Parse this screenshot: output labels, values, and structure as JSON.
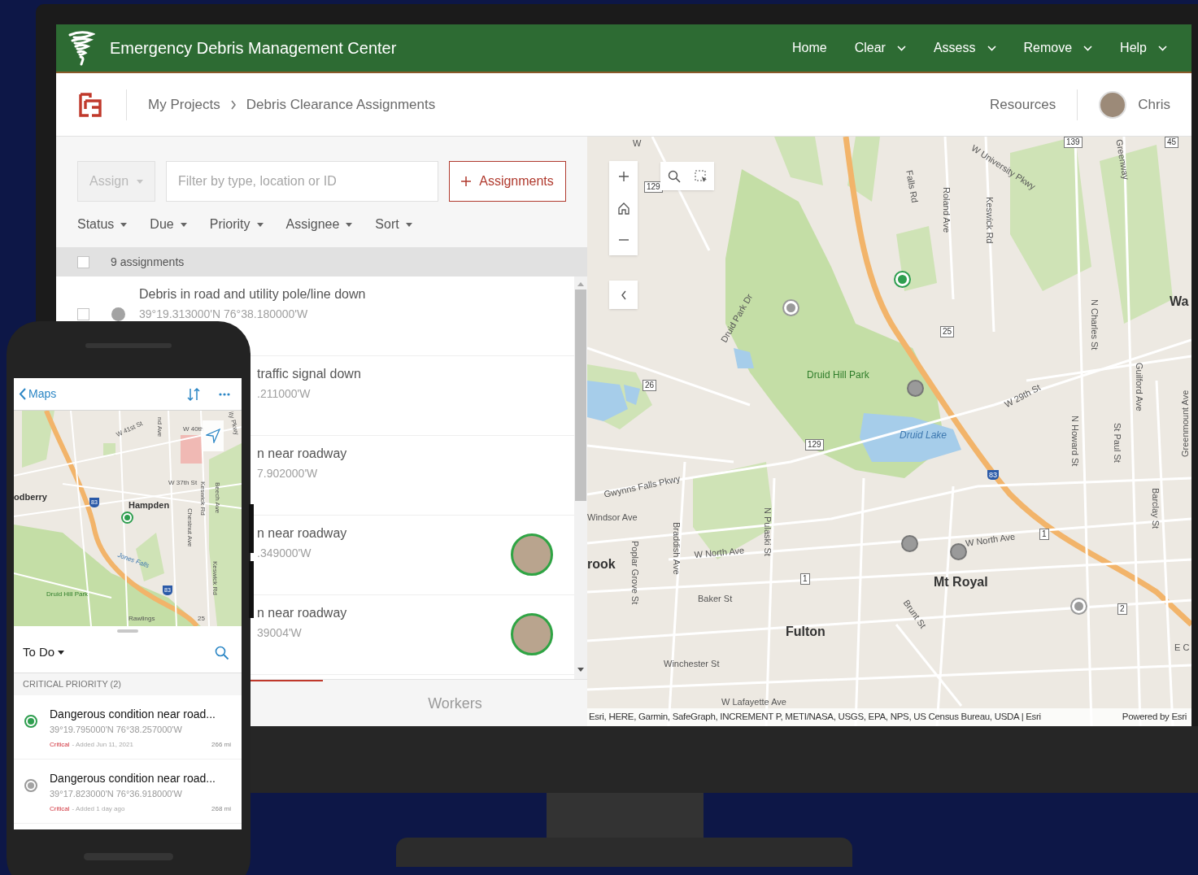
{
  "app": {
    "title": "Emergency Debris Management Center",
    "nav": [
      {
        "label": "Home",
        "menu": false
      },
      {
        "label": "Clear",
        "menu": true
      },
      {
        "label": "Assess",
        "menu": true
      },
      {
        "label": "Remove",
        "menu": true
      },
      {
        "label": "Help",
        "menu": true
      }
    ]
  },
  "breadcrumb": [
    "My Projects",
    "Debris Clearance Assignments"
  ],
  "user_bar": {
    "resources": "Resources",
    "user": "Chris"
  },
  "toolbar": {
    "assign": "Assign",
    "filter_placeholder": "Filter by type, location or ID",
    "add_button": "Assignments"
  },
  "filters": [
    "Status",
    "Due",
    "Priority",
    "Assignee",
    "Sort"
  ],
  "list_header": {
    "count": "9 assignments",
    "checked": false
  },
  "rows": [
    {
      "kind": "full",
      "title": "Debris in road and utility pole/line down",
      "coords": "39°19.313000'N 76°38.180000'W",
      "checked": false,
      "color": "#a3a3a3",
      "assigned": false
    },
    {
      "kind": "covered",
      "title": "traffic signal down",
      "coords": ".211000'W",
      "assigned": false
    },
    {
      "kind": "covered",
      "title": "n near roadway",
      "coords": "7.902000'W",
      "assigned": false
    },
    {
      "kind": "covered",
      "title": "n near roadway",
      "coords": ".349000'W",
      "assigned": true
    },
    {
      "kind": "covered",
      "title": "n near roadway",
      "coords": "39004'W",
      "assigned": true
    }
  ],
  "tabs": [
    {
      "selected": true
    },
    {
      "label": "Workers",
      "selected": false
    }
  ],
  "map": {
    "labels": [
      {
        "kind": "street",
        "text": "W"
      },
      {
        "kind": "street",
        "text": "W University Pkwy"
      },
      {
        "kind": "street",
        "text": "Falls Rd"
      },
      {
        "kind": "street",
        "text": "Roland Ave"
      },
      {
        "kind": "street",
        "text": "Keswick Rd"
      },
      {
        "kind": "street",
        "text": "Greenway"
      },
      {
        "kind": "place",
        "text": "Wa"
      },
      {
        "kind": "street",
        "text": "Druid Park Dr"
      },
      {
        "kind": "park",
        "text": "Druid Hill Park"
      },
      {
        "kind": "water",
        "text": "Druid Lake"
      },
      {
        "kind": "street",
        "text": "W 29th St"
      },
      {
        "kind": "street",
        "text": "N Charles St"
      },
      {
        "kind": "street",
        "text": "Guilford Ave"
      },
      {
        "kind": "street",
        "text": "Greenmount Ave"
      },
      {
        "kind": "street",
        "text": "N Howard St"
      },
      {
        "kind": "street",
        "text": "St Paul St"
      },
      {
        "kind": "street",
        "text": "Barclay St"
      },
      {
        "kind": "street",
        "text": "Gwynns Falls Pkwy"
      },
      {
        "kind": "street",
        "text": "Windsor Ave"
      },
      {
        "kind": "place",
        "text": "rook"
      },
      {
        "kind": "street",
        "text": "Poplar Grove St"
      },
      {
        "kind": "street",
        "text": "Braddish Ave"
      },
      {
        "kind": "street",
        "text": "W North Ave"
      },
      {
        "kind": "street",
        "text": "N Pulaski St"
      },
      {
        "kind": "street",
        "text": "Baker St"
      },
      {
        "kind": "place",
        "text": "Fulton"
      },
      {
        "kind": "place",
        "text": "Mt Royal"
      },
      {
        "kind": "street",
        "text": "Brunt St"
      },
      {
        "kind": "street",
        "text": "W North Ave"
      },
      {
        "kind": "street",
        "text": "Winchester St"
      },
      {
        "kind": "street",
        "text": "W Lafayette Ave"
      },
      {
        "kind": "street",
        "text": "E C"
      },
      {
        "kind": "shield",
        "text": "129"
      },
      {
        "kind": "shield",
        "text": "139"
      },
      {
        "kind": "shield",
        "text": "45"
      },
      {
        "kind": "shield",
        "text": "25"
      },
      {
        "kind": "shield",
        "text": "26"
      },
      {
        "kind": "shield",
        "text": "129"
      },
      {
        "kind": "interstate",
        "text": "83"
      },
      {
        "kind": "shield",
        "text": "1"
      },
      {
        "kind": "shield",
        "text": "1"
      },
      {
        "kind": "shield",
        "text": "2"
      }
    ],
    "pins": [
      {
        "color": "#9a9a9a",
        "ring": true
      },
      {
        "color": "#2e9e4f",
        "ring": true
      },
      {
        "color": "#9a9a9a",
        "ring": false
      },
      {
        "color": "#9a9a9a",
        "ring": false
      },
      {
        "color": "#9a9a9a",
        "ring": false
      },
      {
        "color": "#9a9a9a",
        "ring": true
      }
    ],
    "attribution": "Esri, HERE, Garmin, SafeGraph, INCREMENT P, METI/NASA, USGS, EPA, NPS, US Census Bureau, USDA | Esri",
    "powered": "Powered by Esri"
  },
  "phone": {
    "back": "Maps",
    "map_labels": [
      {
        "kind": "street",
        "text": "W 41st St"
      },
      {
        "kind": "street",
        "text": "nd Ave"
      },
      {
        "kind": "street",
        "text": "W 40th"
      },
      {
        "kind": "street",
        "text": "ity Pkwy"
      },
      {
        "kind": "street",
        "text": "W 37th St"
      },
      {
        "kind": "place",
        "text": "odberry"
      },
      {
        "kind": "place",
        "text": "Hampden"
      },
      {
        "kind": "street",
        "text": "Keswick Rd"
      },
      {
        "kind": "street",
        "text": "Beech Ave"
      },
      {
        "kind": "street",
        "text": "Chestnut Ave"
      },
      {
        "kind": "water",
        "text": "Jones Falls"
      },
      {
        "kind": "street",
        "text": "Keswick Rd"
      },
      {
        "kind": "park",
        "text": "Druid Hill Park"
      },
      {
        "kind": "street",
        "text": "Rawlings"
      },
      {
        "kind": "street",
        "text": "25"
      },
      {
        "kind": "interstate",
        "text": "83"
      },
      {
        "kind": "interstate",
        "text": "83"
      }
    ],
    "list_title": "To Do",
    "section": "CRITICAL PRIORITY (2)",
    "items": [
      {
        "title": "Dangerous condition near road...",
        "coords": "39°19.795000'N 76°38.257000'W",
        "priority": "Critical",
        "added": "- Added Jun 11, 2021",
        "distance": "266 mi",
        "color": "#2e9e4f"
      },
      {
        "title": "Dangerous condition near road...",
        "coords": "39°17.823000'N 76°36.918000'W",
        "priority": "Critical",
        "added": "- Added 1 day ago",
        "distance": "268 mi",
        "color": "#a3a3a3"
      }
    ]
  }
}
